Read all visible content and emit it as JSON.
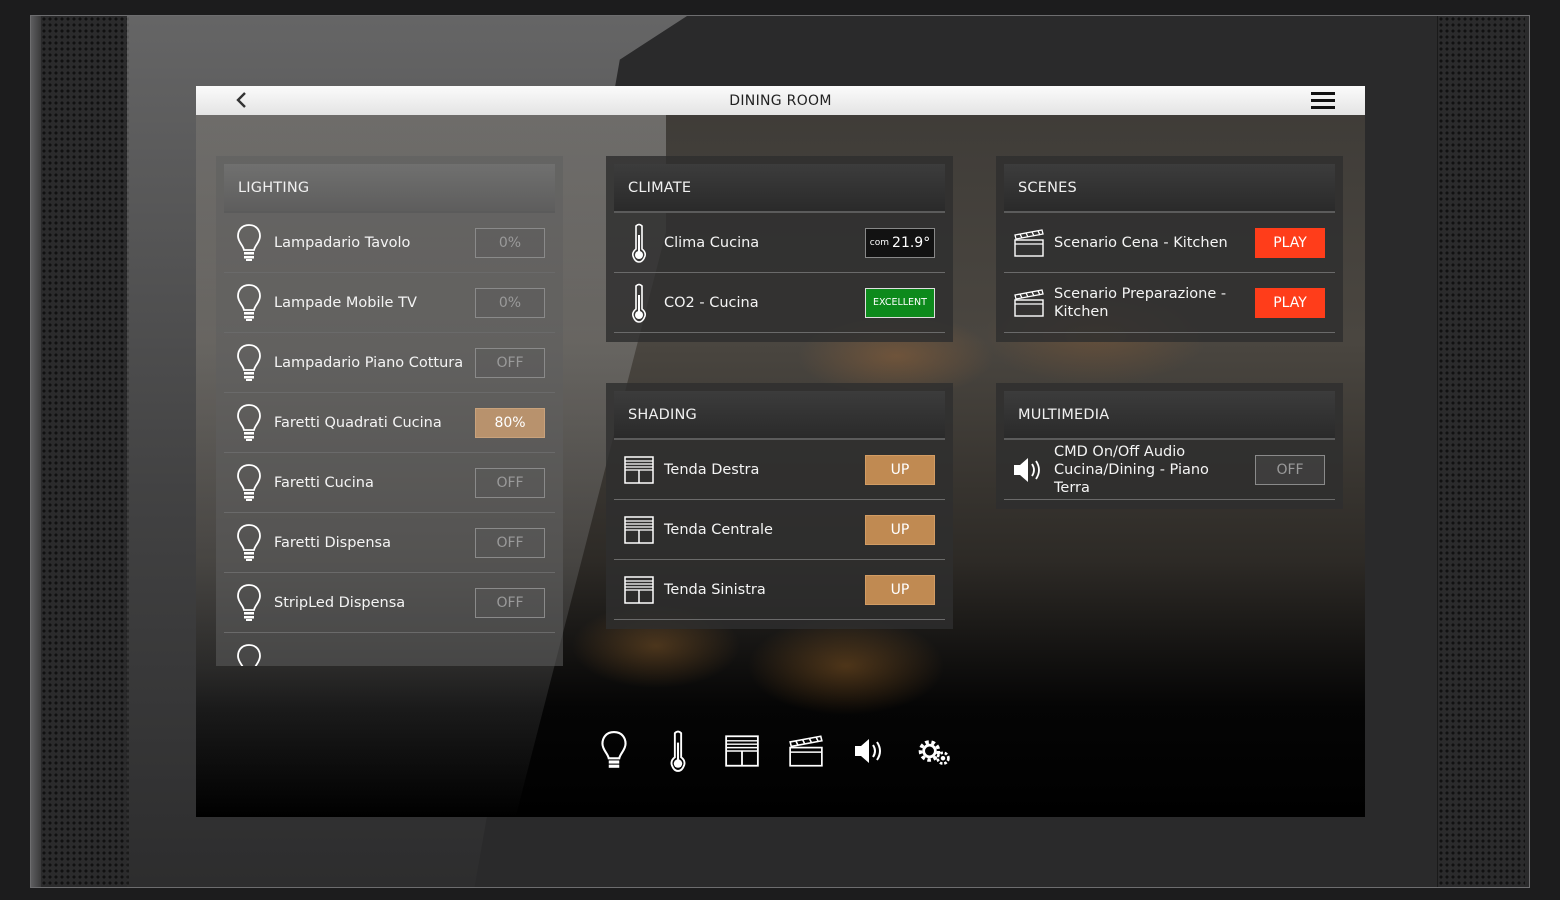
{
  "app": {
    "title": "DINING ROOM"
  },
  "panels": {
    "lighting": {
      "title": "LIGHTING",
      "items": [
        {
          "label": "Lampadario Tavolo",
          "value": "0%"
        },
        {
          "label": "Lampade Mobile TV",
          "value": "0%"
        },
        {
          "label": "Lampadario Piano Cottura",
          "value": "OFF"
        },
        {
          "label": "Faretti Quadrati Cucina",
          "value": "80%"
        },
        {
          "label": "Faretti Cucina",
          "value": "OFF"
        },
        {
          "label": "Faretti Dispensa",
          "value": "OFF"
        },
        {
          "label": "StripLed Dispensa",
          "value": "OFF"
        }
      ]
    },
    "climate": {
      "title": "CLIMATE",
      "items": [
        {
          "label": "Clima Cucina",
          "value_prefix": "com",
          "value": "21.9°"
        },
        {
          "label": "CO2 - Cucina",
          "value": "EXCELLENT"
        }
      ]
    },
    "shading": {
      "title": "SHADING",
      "items": [
        {
          "label": "Tenda Destra",
          "value": "UP"
        },
        {
          "label": "Tenda Centrale",
          "value": "UP"
        },
        {
          "label": "Tenda Sinistra",
          "value": "UP"
        }
      ]
    },
    "scenes": {
      "title": "SCENES",
      "items": [
        {
          "label": "Scenario Cena - Kitchen",
          "value": "PLAY"
        },
        {
          "label": "Scenario Preparazione - Kitchen",
          "value": "PLAY"
        }
      ]
    },
    "multimedia": {
      "title": "MULTIMEDIA",
      "items": [
        {
          "label": "CMD On/Off Audio Cucina/Dining - Piano Terra",
          "value": "OFF"
        }
      ]
    }
  },
  "dock": [
    "lightbulb-icon",
    "thermometer-icon",
    "blinds-icon",
    "clapperboard-icon",
    "speaker-icon",
    "gear-icon"
  ],
  "colors": {
    "play": "#ff3d1a",
    "up": "#c08a52",
    "dim80": "#b8926d",
    "excellent": "#0d8a1c"
  }
}
